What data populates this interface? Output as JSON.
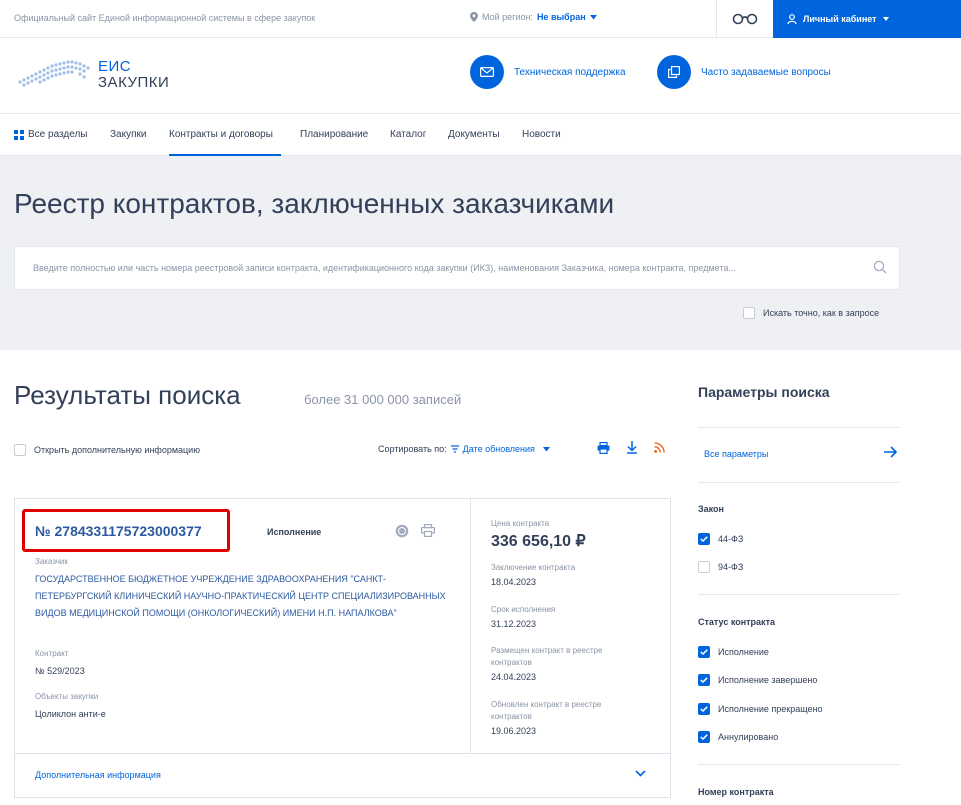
{
  "topbar": {
    "site_label": "Официальный сайт Единой информационной системы в сфере закупок",
    "region_label": "Мой регион:",
    "region_value": "Не выбран",
    "cabinet_label": "Личный кабинет"
  },
  "header": {
    "logo_line1": "ЕИС",
    "logo_line2": "ЗАКУПКИ",
    "support_label": "Техническая поддержка",
    "faq_label": "Часто задаваемые вопросы"
  },
  "nav": {
    "items": [
      "Все разделы",
      "Закупки",
      "Контракты и договоры",
      "Планирование",
      "Каталог",
      "Документы",
      "Новости"
    ]
  },
  "hero": {
    "title": "Реестр контрактов, заключенных заказчиками",
    "search_placeholder": "Введите полностью или часть номера реестровой записи контракта, идентификационного кода закупки (ИКЗ), наименования Заказчика, номера контракта, предмета...",
    "exact_label": "Искать точно, как в запросе"
  },
  "results": {
    "title": "Результаты поиска",
    "count": "более 31 000 000 записей",
    "open_more_label": "Открыть дополнительную информацию",
    "sort_label": "Сортировать по:",
    "sort_value": "Дате обновления"
  },
  "card": {
    "number": "№ 2784331175723000377",
    "status": "Исполнение",
    "customer_label": "Заказчик",
    "customer_name": "ГОСУДАРСТВЕННОЕ БЮДЖЕТНОЕ УЧРЕЖДЕНИЕ ЗДРАВООХРАНЕНИЯ \"САНКТ-ПЕТЕРБУРГСКИЙ КЛИНИЧЕСКИЙ НАУЧНО-ПРАКТИЧЕСКИЙ ЦЕНТР СПЕЦИАЛИЗИРОВАННЫХ ВИДОВ МЕДИЦИНСКОЙ ПОМОЩИ (ОНКОЛОГИЧЕСКИЙ) ИМЕНИ Н.П. НАПАЛКОВА\"",
    "contract_label": "Контракт",
    "contract_value": "№ 529/2023",
    "objects_label": "Объекты закупки",
    "objects_value": "Цоликлон анти-е",
    "price_label": "Цена контракта",
    "price_value": "336 656,10 ₽",
    "conclusion_label": "Заключение контракта",
    "conclusion_value": "18.04.2023",
    "term_label": "Срок исполнения",
    "term_value": "31.12.2023",
    "placed_label_1": "Размещен контракт в реестре",
    "placed_label_2": "контрактов",
    "placed_value": "24.04.2023",
    "updated_label_1": "Обновлен контракт в реестре",
    "updated_label_2": "контрактов",
    "updated_value": "19.06.2023",
    "additional_label": "Дополнительная информация"
  },
  "sidebar": {
    "title": "Параметры поиска",
    "all_params": "Все параметры",
    "law_title": "Закон",
    "law_options": [
      {
        "label": "44-ФЗ",
        "checked": true
      },
      {
        "label": "94-ФЗ",
        "checked": false
      }
    ],
    "status_title": "Статус контракта",
    "status_options": [
      {
        "label": "Исполнение",
        "checked": true
      },
      {
        "label": "Исполнение завершено",
        "checked": true
      },
      {
        "label": "Исполнение прекращено",
        "checked": true
      },
      {
        "label": "Аннулировано",
        "checked": true
      }
    ],
    "number_title": "Номер контракта"
  },
  "colors": {
    "accent": "#0065dd",
    "highlight": "#e00000",
    "hero_bg": "#eff0f4"
  }
}
